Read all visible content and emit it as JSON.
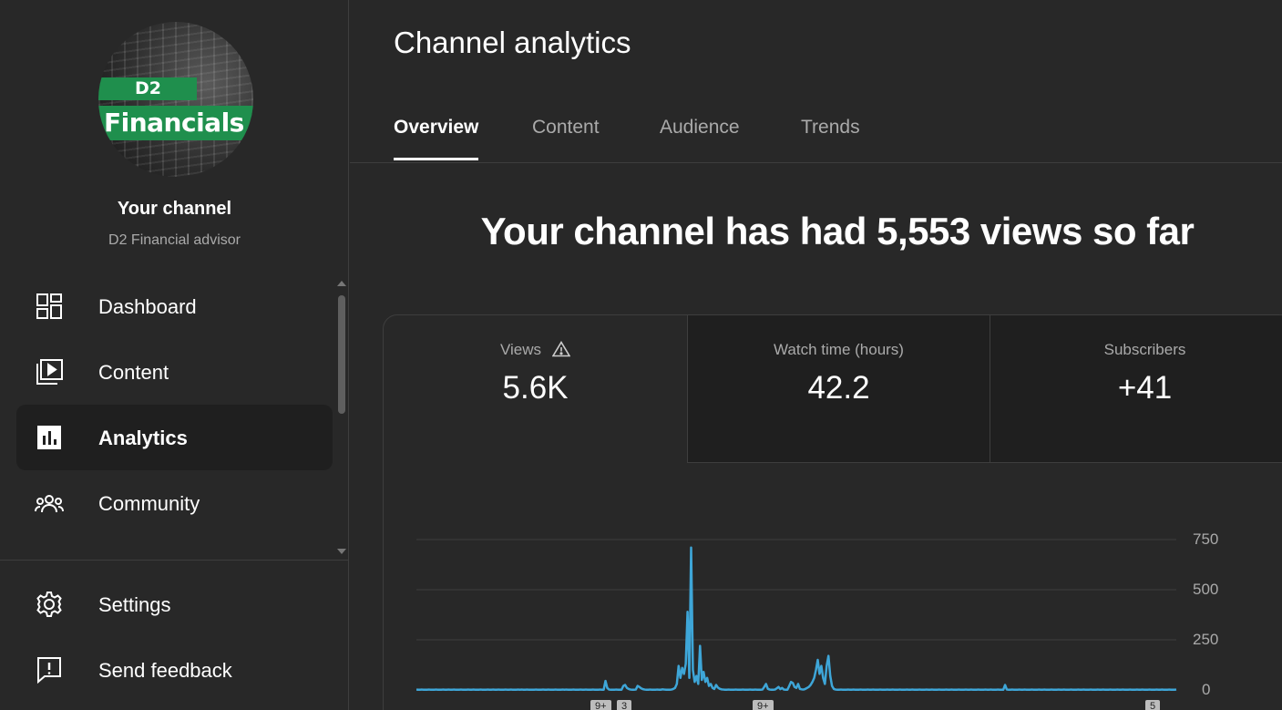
{
  "sidebar": {
    "avatar": {
      "line1": "D2",
      "line2": "Financials"
    },
    "channel_title": "Your channel",
    "channel_subtitle": "D2 Financial advisor",
    "items": [
      {
        "label": "Dashboard",
        "icon": "dashboard-icon"
      },
      {
        "label": "Content",
        "icon": "content-icon"
      },
      {
        "label": "Analytics",
        "icon": "analytics-icon",
        "active": true
      },
      {
        "label": "Community",
        "icon": "community-icon"
      }
    ],
    "bottom_items": [
      {
        "label": "Settings",
        "icon": "gear-icon"
      },
      {
        "label": "Send feedback",
        "icon": "feedback-icon"
      }
    ]
  },
  "main": {
    "title": "Channel analytics",
    "tabs": [
      {
        "label": "Overview",
        "active": true
      },
      {
        "label": "Content"
      },
      {
        "label": "Audience"
      },
      {
        "label": "Trends"
      }
    ],
    "headline": "Your channel has had 5,553 views so far",
    "metrics": [
      {
        "label": "Views",
        "value": "5.6K",
        "warning": true
      },
      {
        "label": "Watch time (hours)",
        "value": "42.2"
      },
      {
        "label": "Subscribers",
        "value": "+41"
      }
    ],
    "markers": [
      "9+",
      "3",
      "9+",
      "5"
    ]
  },
  "colors": {
    "accent_line": "#3ea6d8",
    "background": "#282828",
    "active_bg": "#1f1f1f"
  },
  "chart_data": {
    "type": "line",
    "title": "",
    "xlabel": "",
    "ylabel": "",
    "ylim": [
      0,
      750
    ],
    "yticks": [
      "750",
      "500",
      "250",
      "0"
    ],
    "y_axis_position": "right",
    "grid": true,
    "series": [
      {
        "values": [
          2,
          1,
          1,
          2,
          1,
          1,
          1,
          2,
          1,
          1,
          1,
          2,
          1,
          1,
          1,
          2,
          1,
          1,
          2,
          1,
          1,
          2,
          1,
          1,
          1,
          2,
          1,
          1,
          1,
          2,
          1,
          1,
          2,
          1,
          1,
          1,
          2,
          1,
          1,
          1,
          2,
          1,
          1,
          2,
          1,
          1,
          2,
          1,
          1,
          1,
          2,
          1,
          1,
          2,
          1,
          1,
          1,
          2,
          1,
          2,
          1,
          1,
          2,
          1,
          1,
          1,
          1,
          2,
          1,
          1,
          1,
          2,
          1,
          1,
          2,
          1,
          1,
          1,
          2,
          1,
          1,
          1,
          2,
          1,
          2,
          1,
          1,
          1,
          2,
          1,
          1,
          1,
          2,
          1,
          1,
          2,
          1,
          1,
          1,
          2,
          1,
          1,
          1,
          2,
          1,
          1,
          45,
          10,
          2,
          1,
          1,
          1,
          2,
          1,
          1,
          1,
          20,
          25,
          10,
          5,
          2,
          1,
          1,
          2,
          20,
          15,
          8,
          4,
          2,
          1,
          1,
          2,
          1,
          1,
          1,
          2,
          1,
          1,
          3,
          2,
          1,
          1,
          1,
          2,
          5,
          10,
          30,
          120,
          60,
          110,
          80,
          130,
          390,
          60,
          710,
          100,
          40,
          70,
          30,
          220,
          50,
          90,
          40,
          60,
          20,
          30,
          10,
          5,
          25,
          12,
          6,
          3,
          2,
          1,
          1,
          2,
          1,
          1,
          1,
          2,
          1,
          1,
          1,
          2,
          1,
          1,
          1,
          2,
          1,
          1,
          2,
          1,
          1,
          1,
          2,
          15,
          30,
          6,
          2,
          1,
          1,
          2,
          8,
          15,
          4,
          10,
          2,
          1,
          1,
          20,
          40,
          35,
          15,
          10,
          30,
          5,
          3,
          2,
          5,
          10,
          15,
          25,
          40,
          60,
          100,
          150,
          80,
          120,
          60,
          30,
          120,
          170,
          70,
          20,
          5,
          2,
          1,
          1,
          2,
          1,
          1,
          1,
          2,
          1,
          1,
          2,
          1,
          1,
          1,
          2,
          1,
          1,
          1,
          2,
          1,
          1,
          2,
          1,
          1,
          1,
          2,
          1,
          1,
          1,
          2,
          1,
          1,
          2,
          1,
          1,
          1,
          2,
          1,
          1,
          1,
          2,
          1,
          1,
          2,
          1,
          1,
          1,
          2,
          1,
          1,
          1,
          2,
          1,
          1,
          2,
          1,
          1,
          1,
          2,
          1,
          1,
          1,
          2,
          1,
          1,
          2,
          1,
          1,
          1,
          2,
          1,
          1,
          1,
          2,
          1,
          1,
          2,
          1,
          1,
          1,
          2,
          1,
          1,
          1,
          2,
          1,
          1,
          2,
          1,
          1,
          1,
          2,
          1,
          1,
          1,
          25,
          2,
          1,
          1,
          2,
          1,
          1,
          1,
          2,
          1,
          1,
          2,
          1,
          1,
          1,
          2,
          1,
          1,
          1,
          2,
          1,
          1,
          2,
          1,
          1,
          1,
          2,
          1,
          1,
          1,
          2,
          1,
          1,
          2,
          1,
          1,
          1,
          2,
          1,
          1,
          1,
          2,
          1,
          1,
          2,
          1,
          1,
          1,
          2,
          1,
          1,
          1,
          2,
          1,
          1,
          2,
          1,
          1,
          1,
          2,
          1,
          1,
          1,
          2,
          1,
          1,
          2,
          1,
          1,
          1,
          2,
          1,
          1,
          1,
          2,
          1,
          1,
          2,
          1,
          1,
          1,
          2,
          1,
          1,
          1,
          2,
          1,
          1,
          2,
          1,
          1,
          1,
          2,
          1,
          1,
          1,
          2
        ]
      }
    ]
  }
}
